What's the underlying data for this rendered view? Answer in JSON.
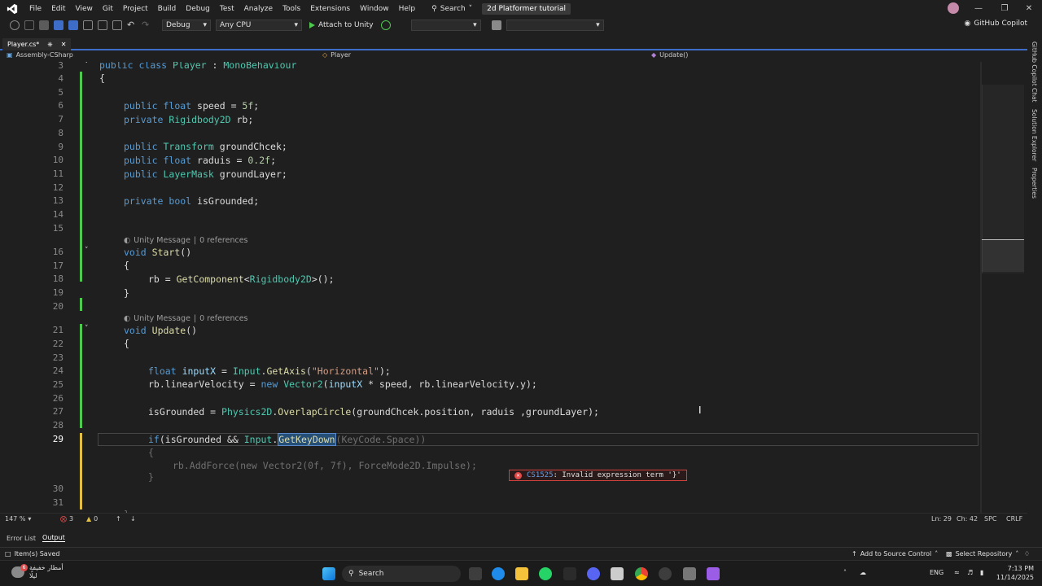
{
  "menu": {
    "items": [
      "File",
      "Edit",
      "View",
      "Git",
      "Project",
      "Build",
      "Debug",
      "Test",
      "Analyze",
      "Tools",
      "Extensions",
      "Window",
      "Help"
    ],
    "search_label": "Search",
    "solution_title": "2d Platformer tutorial"
  },
  "toolbar": {
    "config": "Debug",
    "platform": "Any CPU",
    "attach_label": "Attach to Unity",
    "copilot_label": "GitHub Copilot"
  },
  "tab": {
    "label": "Player.cs*"
  },
  "nav": {
    "project": "Assembly-CSharp",
    "class": "Player",
    "member": "Update()"
  },
  "right_dock": [
    "GitHub Copilot Chat",
    "Solution Explorer",
    "Properties"
  ],
  "editor": {
    "lines": [
      {
        "n": "3",
        "text": "public class Player : MonoBehaviour"
      },
      {
        "n": "4",
        "text": "{"
      },
      {
        "n": "5",
        "text": ""
      },
      {
        "n": "6",
        "text": "public float speed = 5f;"
      },
      {
        "n": "7",
        "text": "private Rigidbody2D rb;"
      },
      {
        "n": "8",
        "text": ""
      },
      {
        "n": "9",
        "text": "public Transform groundChcek;"
      },
      {
        "n": "10",
        "text": "public float raduis = 0.2f;"
      },
      {
        "n": "11",
        "text": "public LayerMask groundLayer;"
      },
      {
        "n": "12",
        "text": ""
      },
      {
        "n": "13",
        "text": "private bool isGrounded;"
      },
      {
        "n": "14",
        "text": ""
      },
      {
        "n": "15",
        "text": ""
      },
      {
        "n": "16",
        "text": "void Start()"
      },
      {
        "n": "17",
        "text": "{"
      },
      {
        "n": "18",
        "text": "rb = GetComponent<Rigidbody2D>();"
      },
      {
        "n": "19",
        "text": "}"
      },
      {
        "n": "20",
        "text": ""
      },
      {
        "n": "21",
        "text": "void Update()"
      },
      {
        "n": "22",
        "text": "{"
      },
      {
        "n": "23",
        "text": ""
      },
      {
        "n": "24",
        "text": "float inputX = Input.GetAxis(\"Horizontal\");"
      },
      {
        "n": "25",
        "text": "rb.linearVelocity = new Vector2(inputX * speed, rb.linearVelocity.y);"
      },
      {
        "n": "26",
        "text": ""
      },
      {
        "n": "27",
        "text": "isGrounded = Physics2D.OverlapCircle(groundChcek.position, raduis ,groundLayer);"
      },
      {
        "n": "28",
        "text": ""
      },
      {
        "n": "29",
        "text": "if(isGrounded && Input.GetKeyDown(KeyCode.Space))"
      },
      {
        "n": "30",
        "text": ""
      },
      {
        "n": "31",
        "text": ""
      }
    ],
    "codelens_unity": "Unity Message",
    "codelens_refs": "0 references",
    "ghost_lines": [
      "{",
      "rb.AddForce(new Vector2(0f, 7f), ForceMode2D.Impulse);",
      "}"
    ],
    "error_code": "CS1525",
    "error_message": ": Invalid expression term '}'"
  },
  "editor_status": {
    "zoom": "147 %",
    "errors": "3",
    "warnings": "0",
    "line": "Ln: 29",
    "col": "Ch: 42",
    "whitespace": "SPC",
    "eol": "CRLF"
  },
  "bottom_tabs": [
    "Error List",
    "Output"
  ],
  "statusbar": {
    "saved": "Item(s) Saved",
    "source_control": "Add to Source Control",
    "repo": "Select Repository"
  },
  "taskbar": {
    "weather_line1": "أمطار خفيفة",
    "weather_line2": "ليلًا",
    "weather_badge": "6",
    "search": "Search",
    "lang": "ENG",
    "time": "7:13 PM",
    "date": "11/14/2025"
  },
  "colors": {
    "accent": "#3e6cc9",
    "change_green": "#4ec94e",
    "change_yellow": "#e2c043",
    "error_red": "#e04b4b"
  }
}
